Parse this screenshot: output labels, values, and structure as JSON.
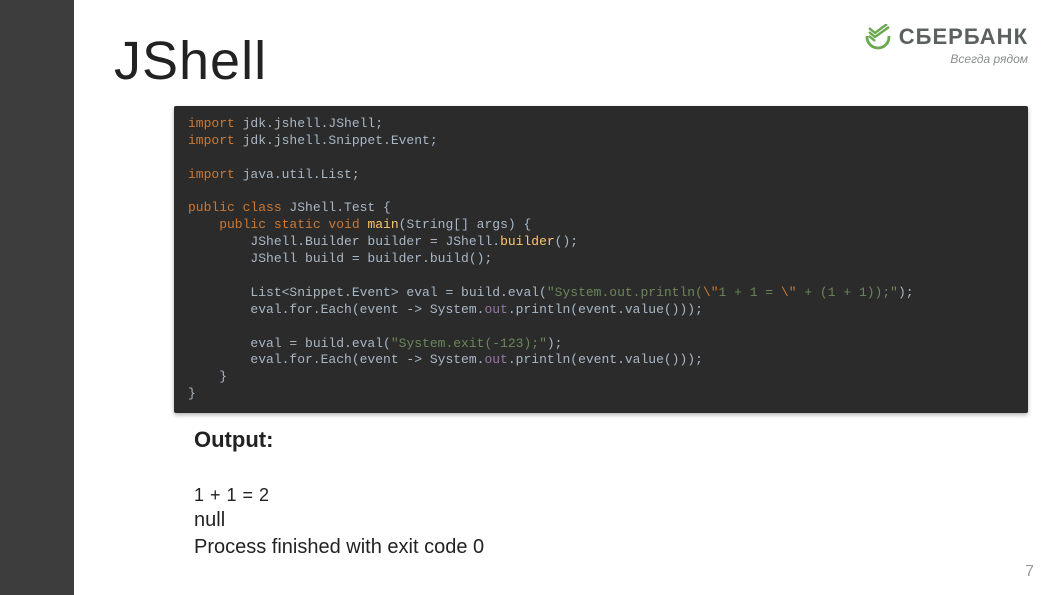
{
  "page": {
    "title": "JShell",
    "number": "7"
  },
  "logo": {
    "text": "СБЕРБАНК",
    "tagline": "Всегда рядом"
  },
  "code": {
    "l1a": "import ",
    "l1b": "jdk.jshell.JShell;",
    "l2a": "import ",
    "l2b": "jdk.jshell.Snippet.Event;",
    "l3": "",
    "l4a": "import ",
    "l4b": "java.util.List;",
    "l5": "",
    "l6a": "public class ",
    "l6b": "JShell.Test {",
    "l7a": "    public static void ",
    "l7b": "main",
    "l7c": "(String[] args) {",
    "l8a": "        JShell.Builder builder = JShell.",
    "l8b": "builder",
    "l8c": "();",
    "l9": "        JShell build = builder.build();",
    "l10": "",
    "l11a": "        List<Snippet.Event> eval = build.eval(",
    "l11b": "\"System.out.println(",
    "l11c": "\\\"",
    "l11d": "1 + 1 = ",
    "l11e": "\\\"",
    "l11f": " + (1 + 1));\"",
    "l11g": ");",
    "l12a": "        eval.for.Each(event -> System.",
    "l12b": "out",
    "l12c": ".println(event.value()));",
    "l13": "",
    "l14a": "        eval = build.eval(",
    "l14b": "\"System.exit(-123);\"",
    "l14c": ");",
    "l15a": "        eval.for.Each(event -> System.",
    "l15b": "out",
    "l15c": ".println(event.value()));",
    "l16": "    }",
    "l17": "}"
  },
  "output": {
    "header": "Output:",
    "line1": "1 + 1 = 2",
    "line2": "null",
    "line3": "Process finished with exit code 0"
  }
}
